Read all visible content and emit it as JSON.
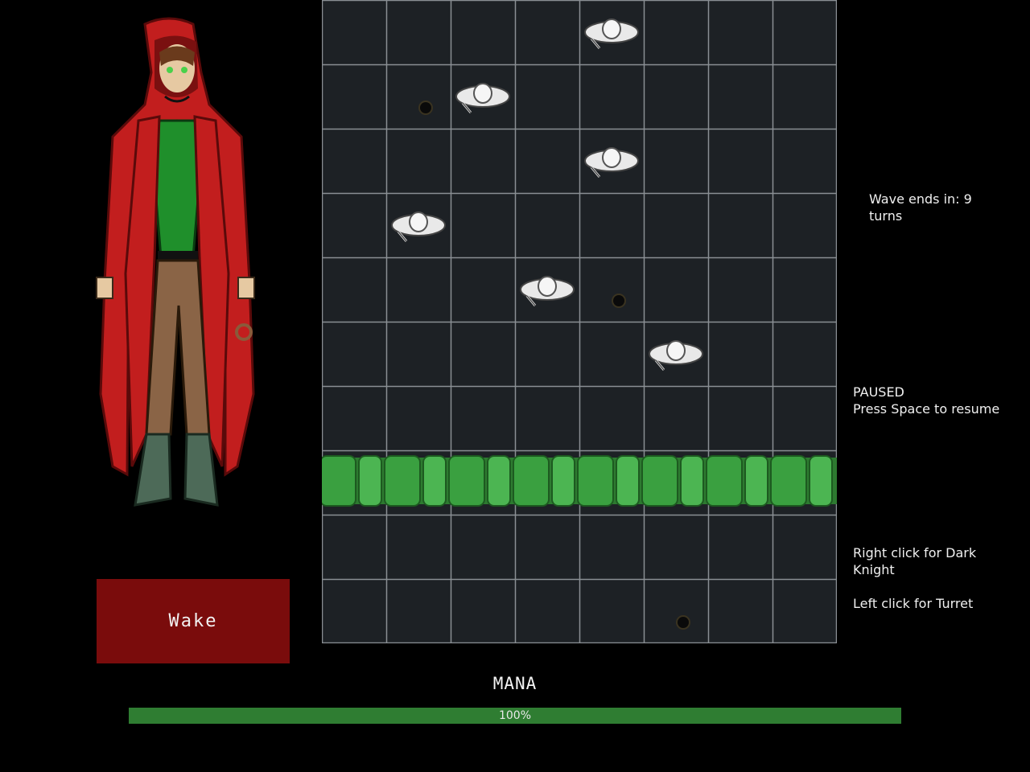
{
  "portrait": {
    "name": "character-portrait"
  },
  "wake_button": {
    "label": "Wake"
  },
  "board": {
    "cols": 8,
    "rows": 10,
    "enemies": [
      {
        "col": 4,
        "row": 0
      },
      {
        "col": 2,
        "row": 1
      },
      {
        "col": 4,
        "row": 2
      },
      {
        "col": 1,
        "row": 3
      },
      {
        "col": 3,
        "row": 4
      },
      {
        "col": 5,
        "row": 5
      }
    ],
    "holes": [
      {
        "col": 1,
        "row": 1
      },
      {
        "col": 4,
        "row": 4
      },
      {
        "col": 5,
        "row": 9
      }
    ],
    "hedge_row": 7
  },
  "status": {
    "wave": "Wave ends in: 9\nturns",
    "paused": "PAUSED\nPress Space to resume",
    "right_click": "Right click for Dark\nKnight",
    "left_click": "Left click for Turret"
  },
  "mana": {
    "label": "MANA",
    "percent_text": "100%",
    "fraction": 1.0
  },
  "colors": {
    "mana_fill": "#2f7d32",
    "wake_button": "#7a0c0c",
    "board_bg": "#1d2125",
    "grid_line": "#8a8f94",
    "hedge": "#3a9a3e"
  }
}
